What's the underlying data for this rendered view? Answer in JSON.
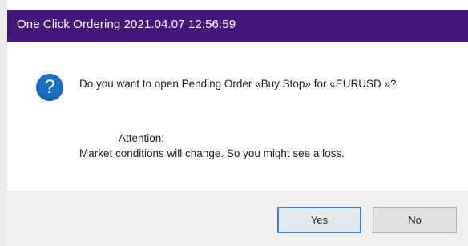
{
  "window": {
    "title": "One Click Ordering 2021.04.07 12:56:59"
  },
  "dialog": {
    "icon": "question-icon",
    "message": "Do you want to open Pending Order «Buy Stop» for «EURUSD »?",
    "attention_label": "Attention:",
    "warning_text": "Market conditions will change. So you might see a loss."
  },
  "buttons": {
    "yes_label": "Yes",
    "no_label": "No"
  },
  "colors": {
    "titlebar": "#45177d",
    "icon": "#1c6fc9",
    "default_button_border": "#3f7fd1"
  }
}
